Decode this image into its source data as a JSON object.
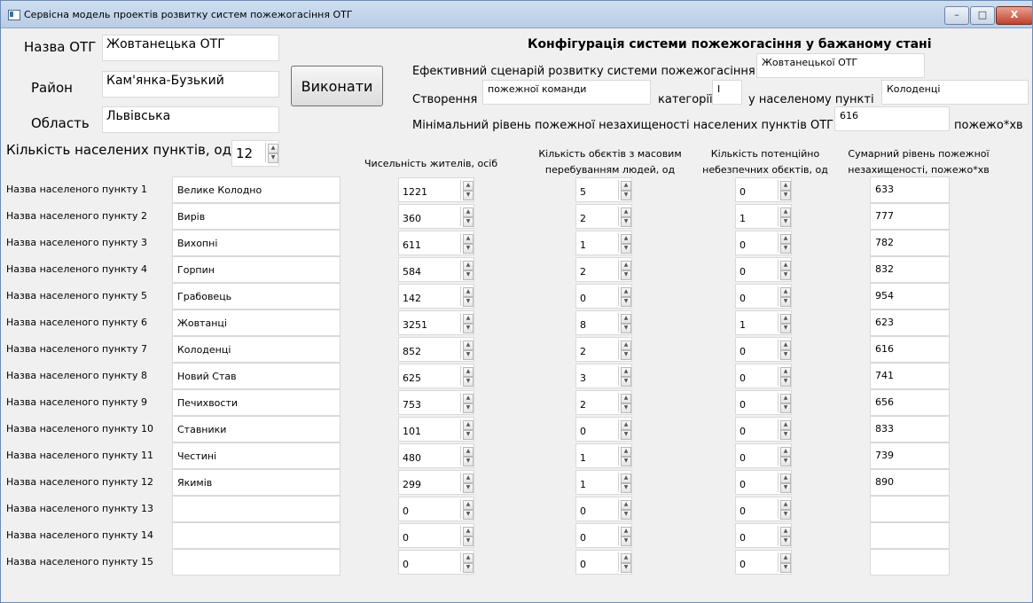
{
  "window": {
    "title": "Сервісна модель проектів розвитку систем пожежогасіння ОТГ",
    "min": "–",
    "max": "□",
    "close": "X"
  },
  "form": {
    "otg_label": "Назва ОТГ",
    "otg_value": "Жовтанецька ОТГ",
    "district_label": "Район",
    "district_value": "Кам'янка-Бузький",
    "region_label": "Область",
    "region_value": "Львівська",
    "run_button": "Виконати",
    "count_label": "Кількість населених пунктів, од",
    "count_value": "12"
  },
  "config": {
    "title": "Конфігурація системи пожежогасіння у бажаному стані",
    "scenario_label": "Ефективний сценарій розвитку системи пожежогасіння",
    "scenario_value": "Жовтанецької ОТГ",
    "create_label": "Створення",
    "create_value": "пожежної команди",
    "category_label": "категорії",
    "category_value": "I",
    "village_label": "у населеному пункті",
    "village_value": "Колоденці",
    "min_label": "Мінімальний рівень пожежної незахищеності населених пунктів ОТГ",
    "min_value": "616",
    "min_unit": "пожежо*хв"
  },
  "table": {
    "headers": {
      "population": "Чисельність жителів, осіб",
      "mass_line1": "Кількість обєктів з масовим",
      "mass_line2": "перебуванням людей, од",
      "danger_line1": "Кількість потенційно",
      "danger_line2": "небезпечних обєктів, од",
      "total_line1": "Сумарний рівень пожежної",
      "total_line2": "незахищеності, пожежо*хв"
    },
    "rows": [
      {
        "label": "Назва населеного пункту 1",
        "name": "Велике Колодно",
        "population": "1221",
        "mass": "5",
        "danger": "0",
        "total": "633"
      },
      {
        "label": "Назва населеного пункту 2",
        "name": "Вирів",
        "population": "360",
        "mass": "2",
        "danger": "1",
        "total": "777"
      },
      {
        "label": "Назва населеного пункту 3",
        "name": "Вихопні",
        "population": "611",
        "mass": "1",
        "danger": "0",
        "total": "782"
      },
      {
        "label": "Назва населеного пункту 4",
        "name": "Горпин",
        "population": "584",
        "mass": "2",
        "danger": "0",
        "total": "832"
      },
      {
        "label": "Назва населеного пункту 5",
        "name": "Грабовець",
        "population": "142",
        "mass": "0",
        "danger": "0",
        "total": "954"
      },
      {
        "label": "Назва населеного пункту 6",
        "name": "Жовтанці",
        "population": "3251",
        "mass": "8",
        "danger": "1",
        "total": "623"
      },
      {
        "label": "Назва населеного пункту 7",
        "name": "Колоденці",
        "population": "852",
        "mass": "2",
        "danger": "0",
        "total": "616"
      },
      {
        "label": "Назва населеного пункту 8",
        "name": "Новий Став",
        "population": "625",
        "mass": "3",
        "danger": "0",
        "total": "741"
      },
      {
        "label": "Назва населеного пункту 9",
        "name": "Печихвости",
        "population": "753",
        "mass": "2",
        "danger": "0",
        "total": "656"
      },
      {
        "label": "Назва населеного пункту 10",
        "name": "Ставники",
        "population": "101",
        "mass": "0",
        "danger": "0",
        "total": "833"
      },
      {
        "label": "Назва населеного пункту 11",
        "name": "Честині",
        "population": "480",
        "mass": "1",
        "danger": "0",
        "total": "739"
      },
      {
        "label": "Назва населеного пункту 12",
        "name": "Якимів",
        "population": "299",
        "mass": "1",
        "danger": "0",
        "total": "890"
      },
      {
        "label": "Назва населеного пункту 13",
        "name": "",
        "population": "0",
        "mass": "0",
        "danger": "0",
        "total": ""
      },
      {
        "label": "Назва населеного пункту 14",
        "name": "",
        "population": "0",
        "mass": "0",
        "danger": "0",
        "total": ""
      },
      {
        "label": "Назва населеного пункту 15",
        "name": "",
        "population": "0",
        "mass": "0",
        "danger": "0",
        "total": ""
      }
    ]
  }
}
